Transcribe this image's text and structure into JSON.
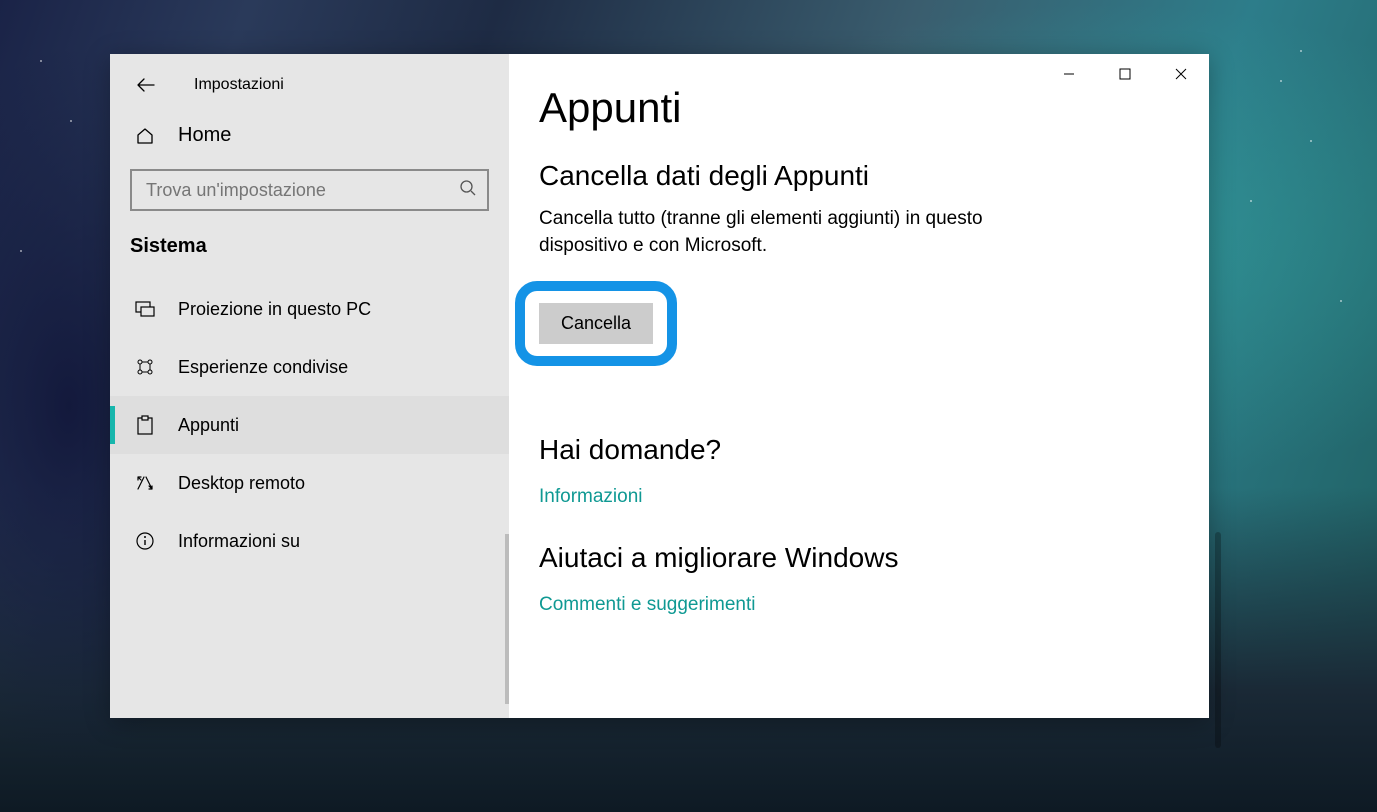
{
  "window": {
    "app_title": "Impostazioni"
  },
  "sidebar": {
    "home_label": "Home",
    "search_placeholder": "Trova un'impostazione",
    "section_label": "Sistema",
    "items": [
      {
        "label": "Proiezione in questo PC"
      },
      {
        "label": "Esperienze condivise"
      },
      {
        "label": "Appunti"
      },
      {
        "label": "Desktop remoto"
      },
      {
        "label": "Informazioni su"
      }
    ],
    "active_index": 2
  },
  "content": {
    "page_title": "Appunti",
    "clear_section": {
      "heading": "Cancella dati degli Appunti",
      "description": "Cancella tutto (tranne gli elementi aggiunti) in questo dispositivo e con Microsoft.",
      "button_label": "Cancella"
    },
    "help_section": {
      "heading": "Hai domande?",
      "link_label": "Informazioni"
    },
    "feedback_section": {
      "heading": "Aiutaci a migliorare Windows",
      "link_label": "Commenti e suggerimenti"
    }
  },
  "colors": {
    "accent": "#17b6ac",
    "highlight": "#1493e6",
    "link": "#0f9993"
  }
}
